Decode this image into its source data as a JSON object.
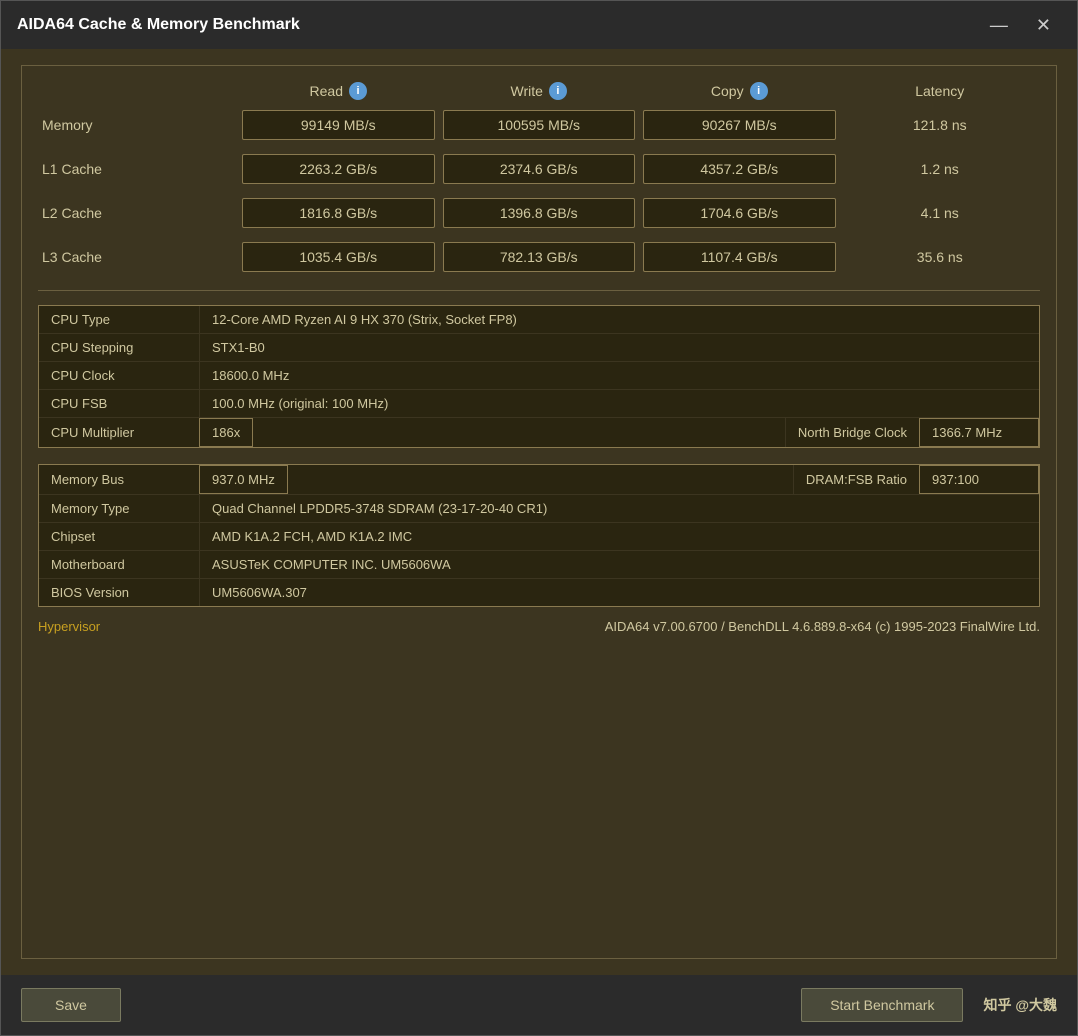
{
  "window": {
    "title": "AIDA64 Cache & Memory Benchmark",
    "minimize_label": "—",
    "close_label": "✕"
  },
  "headers": {
    "read": "Read",
    "write": "Write",
    "copy": "Copy",
    "latency": "Latency"
  },
  "rows": [
    {
      "label": "Memory",
      "read": "99149 MB/s",
      "write": "100595 MB/s",
      "copy": "90267 MB/s",
      "latency": "121.8 ns"
    },
    {
      "label": "L1 Cache",
      "read": "2263.2 GB/s",
      "write": "2374.6 GB/s",
      "copy": "4357.2 GB/s",
      "latency": "1.2 ns"
    },
    {
      "label": "L2 Cache",
      "read": "1816.8 GB/s",
      "write": "1396.8 GB/s",
      "copy": "1704.6 GB/s",
      "latency": "4.1 ns"
    },
    {
      "label": "L3 Cache",
      "read": "1035.4 GB/s",
      "write": "782.13 GB/s",
      "copy": "1107.4 GB/s",
      "latency": "35.6 ns"
    }
  ],
  "cpu_info": {
    "cpu_type_label": "CPU Type",
    "cpu_type_value": "12-Core AMD Ryzen AI 9 HX 370  (Strix, Socket FP8)",
    "cpu_stepping_label": "CPU Stepping",
    "cpu_stepping_value": "STX1-B0",
    "cpu_clock_label": "CPU Clock",
    "cpu_clock_value": "18600.0 MHz",
    "cpu_fsb_label": "CPU FSB",
    "cpu_fsb_value": "100.0 MHz  (original: 100 MHz)",
    "cpu_multiplier_label": "CPU Multiplier",
    "cpu_multiplier_value": "186x",
    "north_bridge_label": "North Bridge Clock",
    "north_bridge_value": "1366.7 MHz"
  },
  "memory_info": {
    "memory_bus_label": "Memory Bus",
    "memory_bus_value": "937.0 MHz",
    "dram_fsb_label": "DRAM:FSB Ratio",
    "dram_fsb_value": "937:100",
    "memory_type_label": "Memory Type",
    "memory_type_value": "Quad Channel LPDDR5-3748 SDRAM  (23-17-20-40 CR1)",
    "chipset_label": "Chipset",
    "chipset_value": "AMD K1A.2 FCH, AMD K1A.2 IMC",
    "motherboard_label": "Motherboard",
    "motherboard_value": "ASUSTeK COMPUTER INC. UM5606WA",
    "bios_label": "BIOS Version",
    "bios_value": "UM5606WA.307"
  },
  "footer": {
    "hypervisor_label": "Hypervisor",
    "hypervisor_value": "AIDA64 v7.00.6700 / BenchDLL 4.6.889.8-x64  (c) 1995-2023 FinalWire Ltd.",
    "watermark": "知乎 @大魏"
  },
  "buttons": {
    "save": "Save",
    "benchmark": "Start Benchmark"
  }
}
